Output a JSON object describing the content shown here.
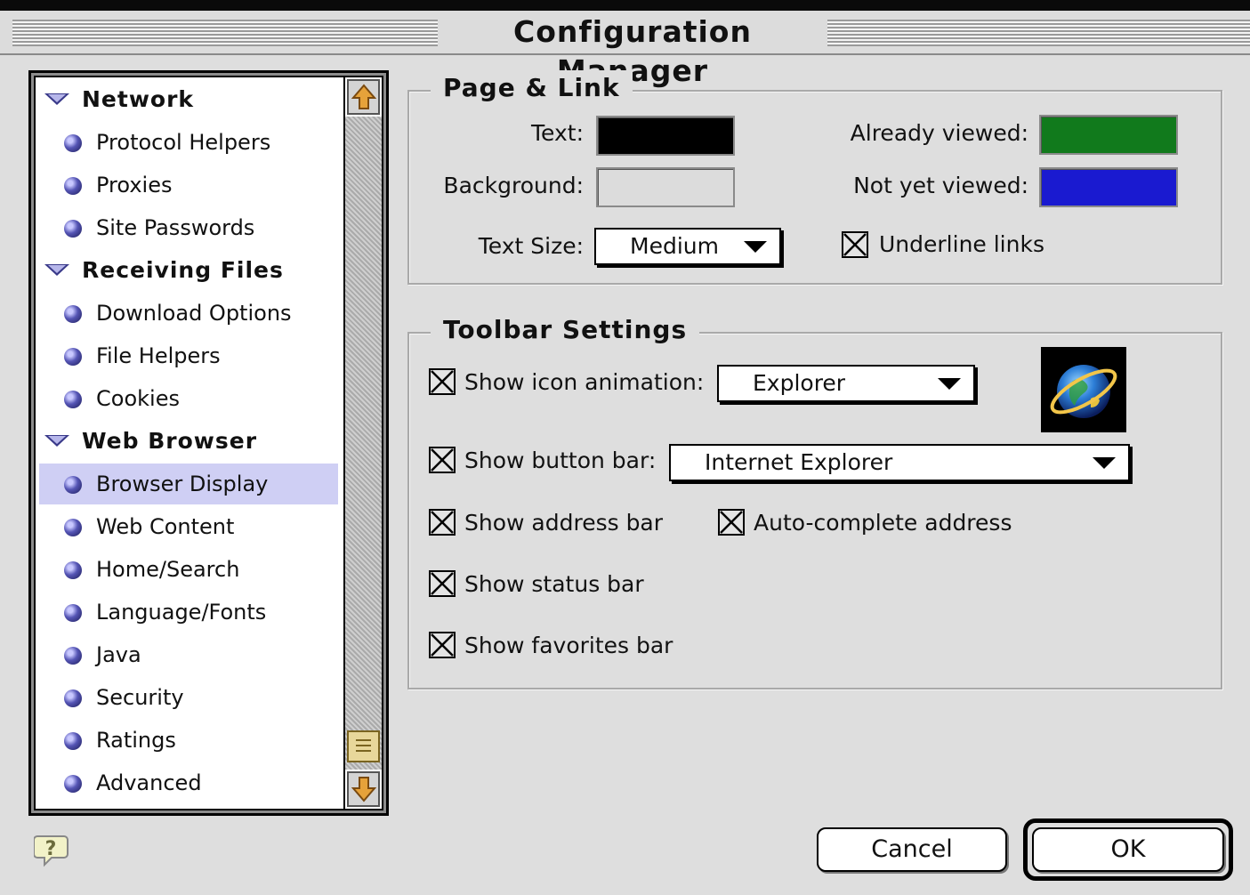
{
  "window": {
    "title": "Configuration Manager"
  },
  "sidebar": {
    "items": [
      {
        "label": "Network",
        "type": "group"
      },
      {
        "label": "Protocol Helpers",
        "type": "leaf"
      },
      {
        "label": "Proxies",
        "type": "leaf"
      },
      {
        "label": "Site Passwords",
        "type": "leaf"
      },
      {
        "label": "Receiving Files",
        "type": "group"
      },
      {
        "label": "Download Options",
        "type": "leaf"
      },
      {
        "label": "File Helpers",
        "type": "leaf"
      },
      {
        "label": "Cookies",
        "type": "leaf"
      },
      {
        "label": "Web Browser",
        "type": "group"
      },
      {
        "label": "Browser Display",
        "type": "leaf",
        "selected": true
      },
      {
        "label": "Web Content",
        "type": "leaf"
      },
      {
        "label": "Home/Search",
        "type": "leaf"
      },
      {
        "label": "Language/Fonts",
        "type": "leaf"
      },
      {
        "label": "Java",
        "type": "leaf"
      },
      {
        "label": "Security",
        "type": "leaf"
      },
      {
        "label": "Ratings",
        "type": "leaf"
      },
      {
        "label": "Advanced",
        "type": "leaf"
      }
    ]
  },
  "page_link": {
    "legend": "Page & Link",
    "text_label": "Text:",
    "text_color": "#000000",
    "background_label": "Background:",
    "background_color": "#dcdcdc",
    "already_viewed_label": "Already viewed:",
    "already_viewed_color": "#117a1c",
    "not_yet_viewed_label": "Not yet viewed:",
    "not_yet_viewed_color": "#1a1ad0",
    "text_size_label": "Text Size:",
    "text_size_value": "Medium",
    "underline_links_label": "Underline links",
    "underline_links_checked": true
  },
  "toolbar_settings": {
    "legend": "Toolbar Settings",
    "show_icon_animation_label": "Show icon animation:",
    "show_icon_animation_checked": true,
    "icon_animation_value": "Explorer",
    "show_button_bar_label": "Show button bar:",
    "show_button_bar_checked": true,
    "button_bar_value": "Internet Explorer",
    "show_address_bar_label": "Show address bar",
    "show_address_bar_checked": true,
    "auto_complete_address_label": "Auto-complete address",
    "auto_complete_address_checked": true,
    "show_status_bar_label": "Show status bar",
    "show_status_bar_checked": true,
    "show_favorites_bar_label": "Show favorites bar",
    "show_favorites_bar_checked": true,
    "preview_icon": "globe-icon"
  },
  "footer": {
    "help_icon": "help-icon",
    "cancel_label": "Cancel",
    "ok_label": "OK"
  }
}
